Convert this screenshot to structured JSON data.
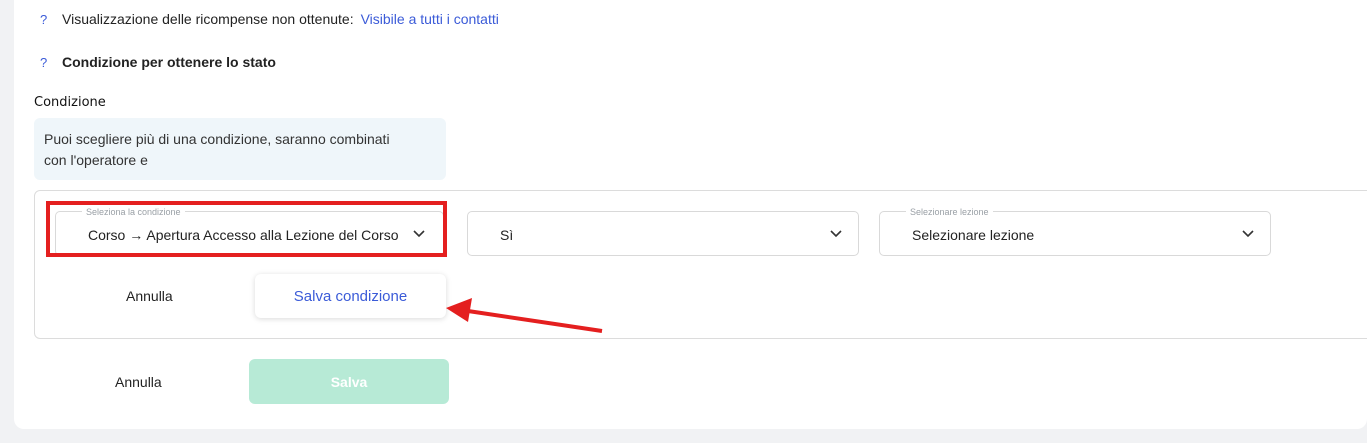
{
  "rows": {
    "rewards_label": "Visualizzazione delle ricompense non ottenute:",
    "rewards_link": "Visibile a tutti i contatti",
    "condition_status_label": "Condizione per ottenere lo stato",
    "help_mark": "?"
  },
  "condition_section": {
    "label": "Condizione",
    "info_line1": "Puoi scegliere più di una condizione, saranno combinati",
    "info_line2": "con l'operatore e"
  },
  "selects": {
    "condition": {
      "floating_label": "Seleziona la condizione",
      "value": "Corso → Apertura Accesso alla Lezione del Corso"
    },
    "yes_no": {
      "value": "Sì"
    },
    "lesson": {
      "floating_label": "Selezionare lezione",
      "value": "Selezionare lezione"
    }
  },
  "condition_actions": {
    "cancel": "Annulla",
    "save": "Salva condizione"
  },
  "form_actions": {
    "cancel": "Annulla",
    "save": "Salva"
  },
  "colors": {
    "accent": "#3b5bd8",
    "annotation": "#e41f1f",
    "save_disabled": "#b7ead6"
  },
  "icons": [
    "chevron-down-icon",
    "annotation-arrow"
  ]
}
